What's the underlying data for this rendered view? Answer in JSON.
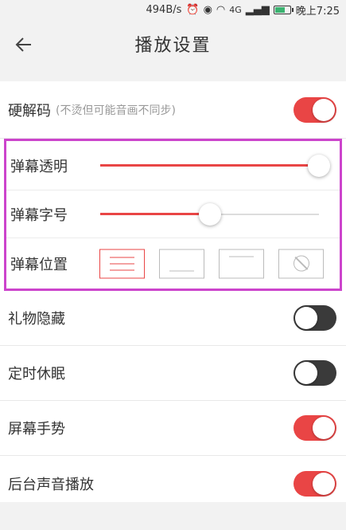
{
  "status_bar": {
    "speed": "494B/s",
    "network": "4G",
    "time": "晚上7:25",
    "battery_fraction": 0.7
  },
  "header": {
    "title": "播放设置",
    "back_icon": "arrow-left-icon"
  },
  "settings": {
    "hard_decode": {
      "label": "硬解码",
      "hint": "(不烫但可能音画不同步)",
      "enabled": true
    },
    "danmu_opacity": {
      "label": "弹幕透明",
      "value": 1.0
    },
    "danmu_font_size": {
      "label": "弹幕字号",
      "value": 0.5
    },
    "danmu_position": {
      "label": "弹幕位置",
      "options": [
        "full",
        "bottom",
        "top",
        "off"
      ],
      "selected": "full"
    },
    "hide_gifts": {
      "label": "礼物隐藏",
      "enabled": false
    },
    "sleep_timer": {
      "label": "定时休眠",
      "enabled": false
    },
    "screen_gesture": {
      "label": "屏幕手势",
      "enabled": true
    },
    "background_audio": {
      "label": "后台声音播放",
      "enabled": true
    }
  },
  "colors": {
    "accent": "#e94545",
    "highlight_border": "#cc44cc",
    "toggle_off": "#3a3a3a"
  }
}
